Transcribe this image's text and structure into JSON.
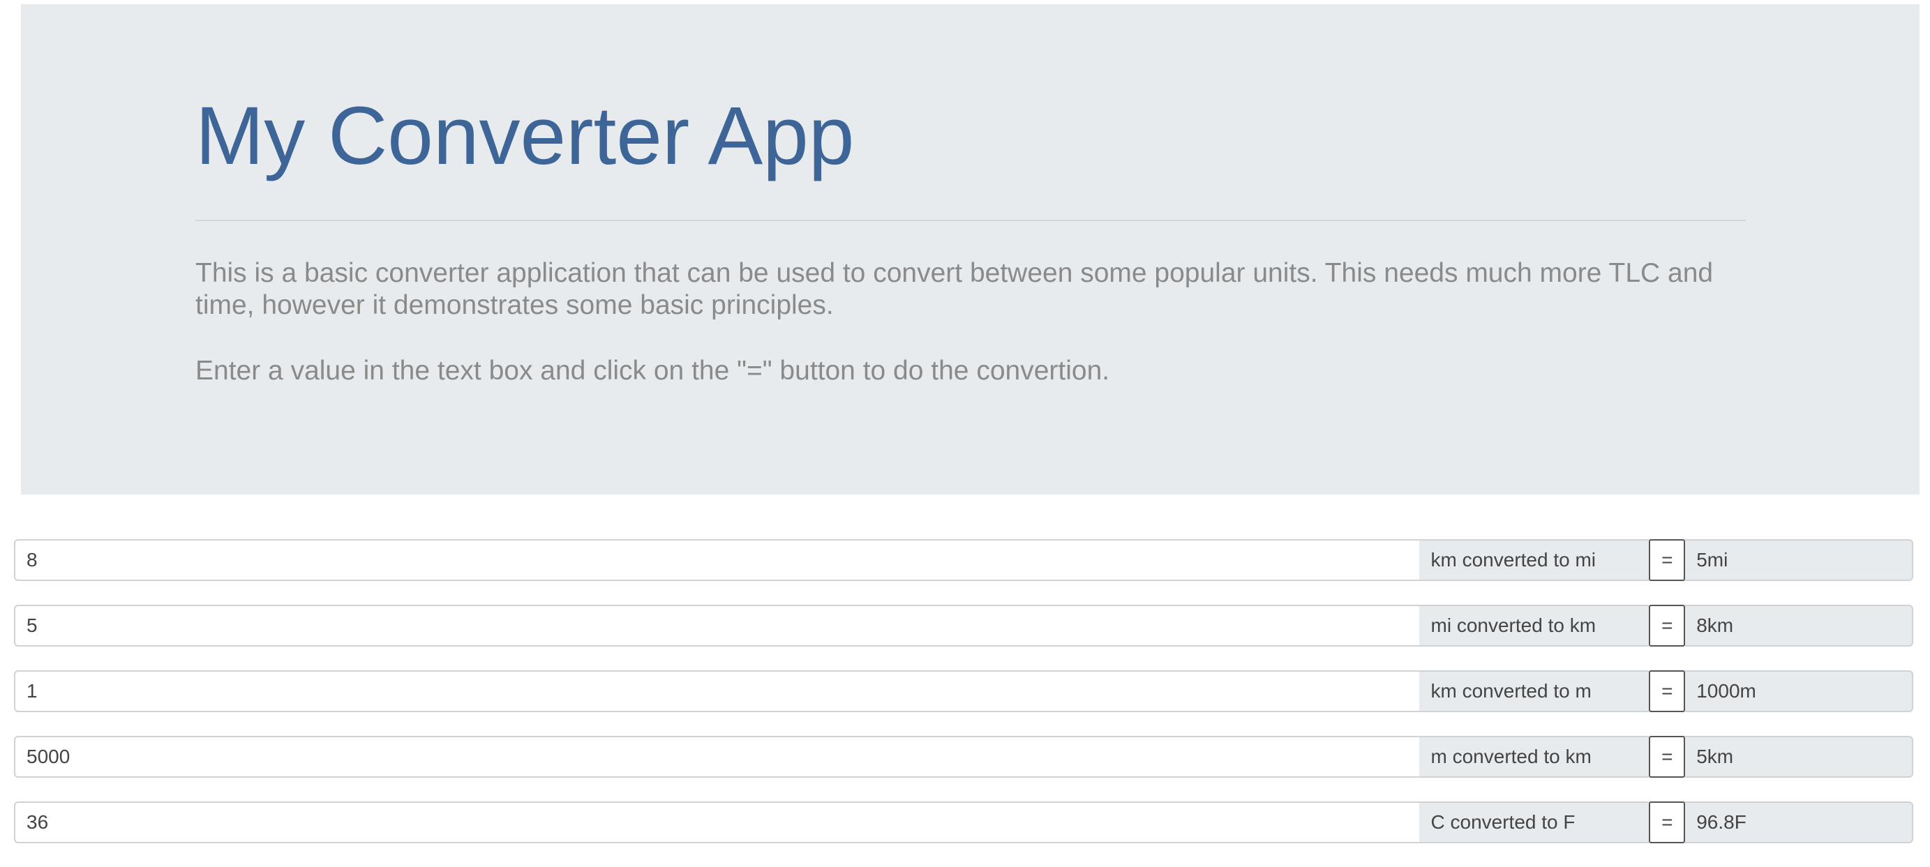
{
  "header": {
    "title": "My Converter App",
    "description": "This is a basic converter application that can be used to convert between some popular units. This needs much more TLC and time, however it demonstrates some basic principles.",
    "instructions": "Enter a value in the text box and click on the \"=\" button to do the convertion."
  },
  "converters": [
    {
      "input_value": "8",
      "label": "km converted to mi",
      "button_label": "=",
      "result": "5mi"
    },
    {
      "input_value": "5",
      "label": "mi converted to km",
      "button_label": "=",
      "result": "8km"
    },
    {
      "input_value": "1",
      "label": "km converted to m",
      "button_label": "=",
      "result": "1000m"
    },
    {
      "input_value": "5000",
      "label": "m converted to km",
      "button_label": "=",
      "result": "5km"
    },
    {
      "input_value": "36",
      "label": "C converted to F",
      "button_label": "=",
      "result": "96.8F"
    }
  ],
  "colors": {
    "title": "#3e6597",
    "jumbotron_bg": "#e8ebee",
    "muted_text": "#8a8a8a"
  }
}
